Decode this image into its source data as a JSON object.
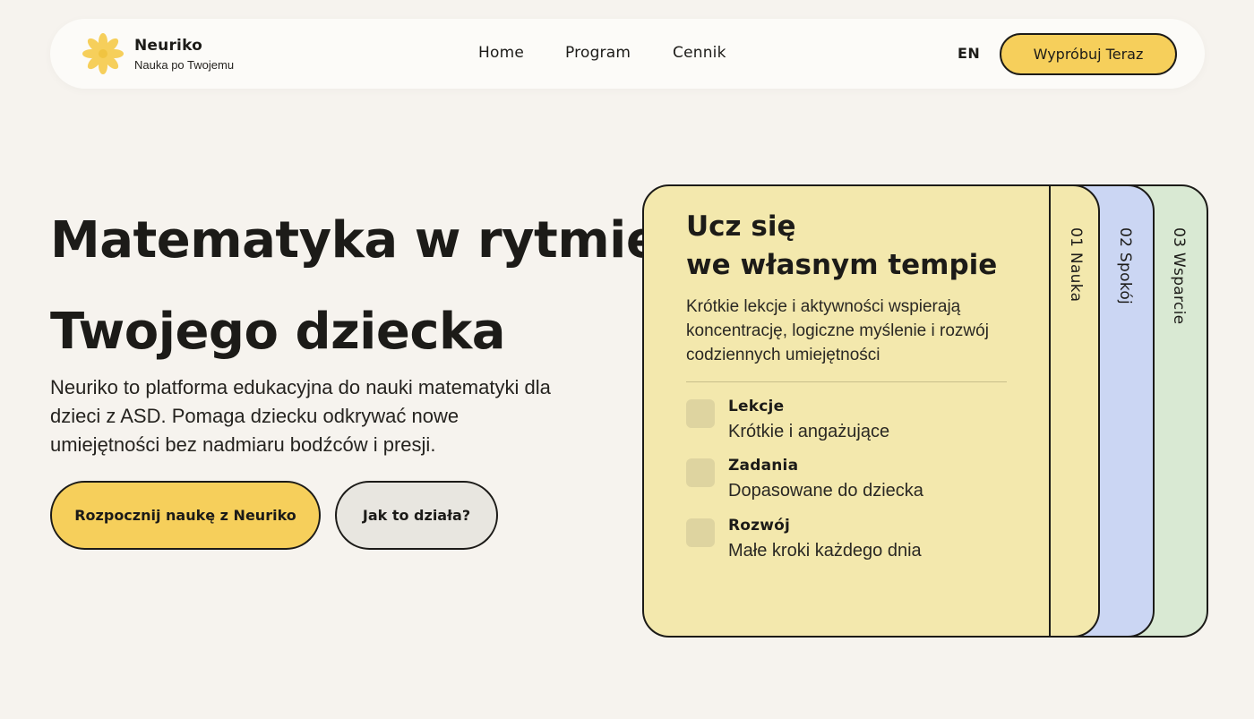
{
  "header": {
    "brand_name": "Neuriko",
    "brand_tagline": "Nauka po Twojemu",
    "nav": [
      "Home",
      "Program",
      "Cennik"
    ],
    "lang": "EN",
    "cta": "Wypróbuj Teraz"
  },
  "hero": {
    "title_lines": [
      "Matematyka w rytmie",
      "Twojego dziecka"
    ],
    "description": "Neuriko to platforma edukacyjna do nauki matematyki dla dzieci z ASD. Pomaga dziecku odkrywać nowe umiejętności bez nadmiaru bodźców i presji.",
    "primary_button": "Rozpocznij naukę z Neuriko",
    "secondary_button": "Jak to działa?"
  },
  "cards": {
    "tabs": [
      "01 Nauka",
      "02 Spokój",
      "03 Wsparcie"
    ],
    "active": {
      "title_lines": [
        "Ucz się",
        "we własnym tempie"
      ],
      "description": "Krótkie lekcje i aktywności wspierają koncentrację, logiczne myślenie i rozwój codziennych umiejętności",
      "features": [
        {
          "title": "Lekcje",
          "subtitle": "Krótkie i angażujące"
        },
        {
          "title": "Zadania",
          "subtitle": "Dopasowane do dziecka"
        },
        {
          "title": "Rozwój",
          "subtitle": "Małe kroki każdego dnia"
        }
      ]
    }
  },
  "colors": {
    "background": "#f6f3ee",
    "accent_yellow": "#f6cf5b",
    "card_yellow": "#f3e8ad",
    "card_blue": "#cbd6f3",
    "card_green": "#d9e9d3",
    "ink": "#1c1b18"
  }
}
